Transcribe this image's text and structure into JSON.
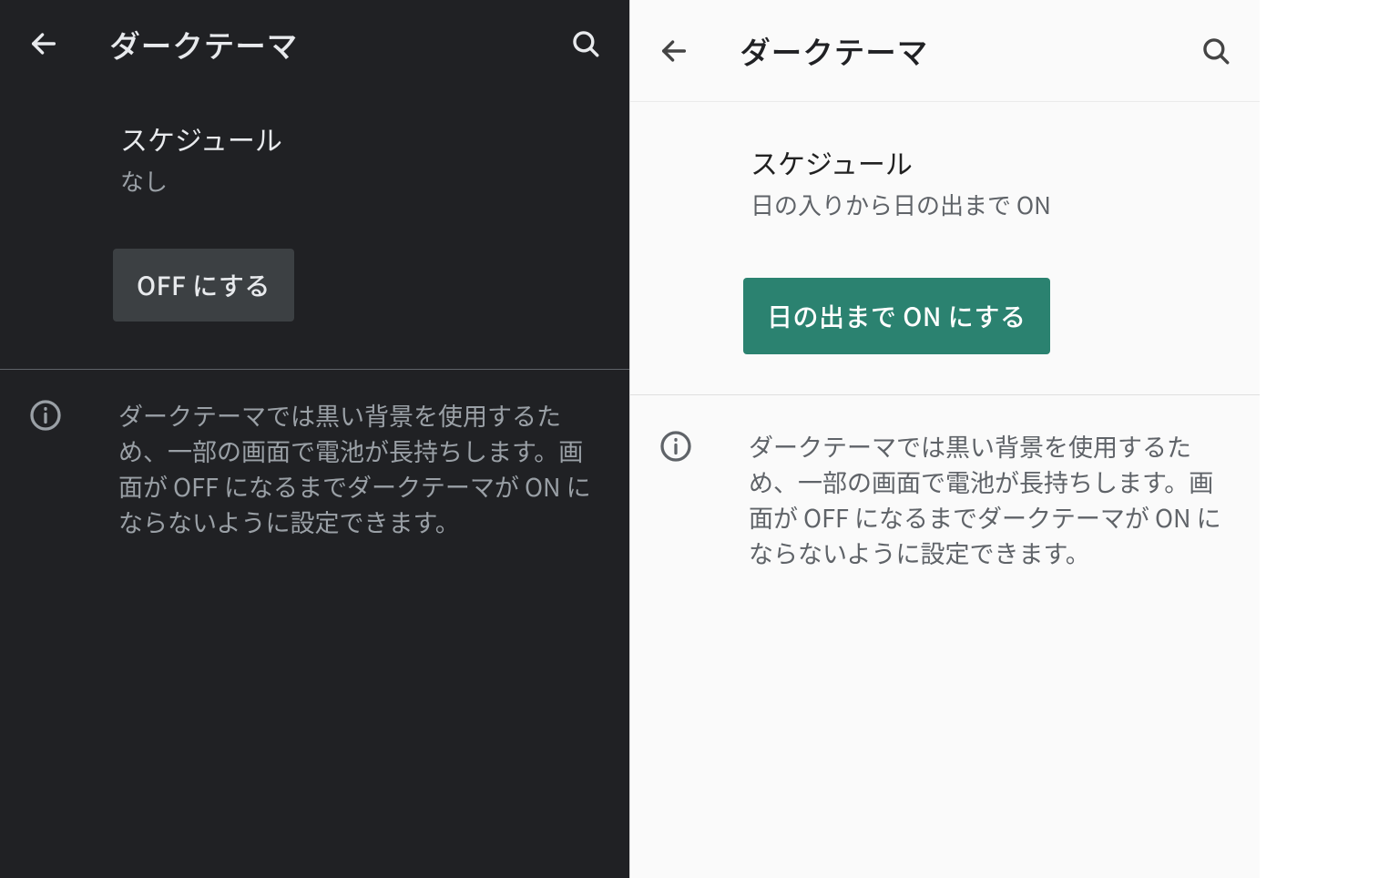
{
  "left": {
    "title": "ダークテーマ",
    "schedule_label": "スケジュール",
    "schedule_value": "なし",
    "action_label": "OFF にする",
    "info_text": "ダークテーマでは黒い背景を使用するため、一部の画面で電池が長持ちします。画面が OFF になるまでダークテーマが ON にならないように設定できます。"
  },
  "right": {
    "title": "ダークテーマ",
    "schedule_label": "スケジュール",
    "schedule_value": "日の入りから日の出まで ON",
    "action_label": "日の出まで ON にする",
    "info_text": "ダークテーマでは黒い背景を使用するため、一部の画面で電池が長持ちします。画面が OFF になるまでダークテーマが ON にならないように設定できます。"
  },
  "colors": {
    "dark_bg": "#202124",
    "dark_button_bg": "#3c4043",
    "light_bg": "#fafafa",
    "teal_button_bg": "#2b8270"
  }
}
